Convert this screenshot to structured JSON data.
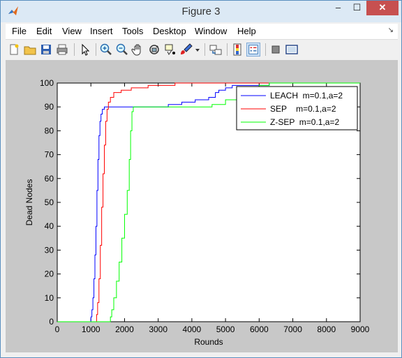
{
  "window": {
    "title": "Figure 3",
    "minimize_glyph": "–",
    "maximize_glyph": "☐",
    "close_glyph": "✕"
  },
  "menu": [
    "File",
    "Edit",
    "View",
    "Insert",
    "Tools",
    "Desktop",
    "Window",
    "Help"
  ],
  "dock_glyph": "↘",
  "toolbar": [
    "new-figure-icon",
    "open-file-icon",
    "save-icon",
    "print-icon",
    "pointer-icon",
    "zoom-in-icon",
    "zoom-out-icon",
    "pan-icon",
    "rotate-3d-icon",
    "data-cursor-icon",
    "brush-icon",
    "brush-dropdown-icon",
    "link-plot-icon",
    "insert-colorbar-icon",
    "insert-legend-icon",
    "hide-plot-tools-icon",
    "show-plot-tools-icon"
  ],
  "chart_data": {
    "type": "line",
    "xlabel": "Rounds",
    "ylabel": "Dead Nodes",
    "xlim": [
      0,
      9000
    ],
    "ylim": [
      0,
      100
    ],
    "xticks": [
      0,
      1000,
      2000,
      3000,
      4000,
      5000,
      6000,
      7000,
      8000,
      9000
    ],
    "yticks": [
      0,
      10,
      20,
      30,
      40,
      50,
      60,
      70,
      80,
      90,
      100
    ],
    "grid": false,
    "legend_position": "top-right",
    "series": [
      {
        "name": "LEACH  m=0.1,a=2",
        "color": "#0000ff",
        "points": [
          [
            0,
            0
          ],
          [
            980,
            0
          ],
          [
            1000,
            2
          ],
          [
            1030,
            5
          ],
          [
            1060,
            10
          ],
          [
            1090,
            18
          ],
          [
            1120,
            28
          ],
          [
            1150,
            40
          ],
          [
            1180,
            55
          ],
          [
            1210,
            68
          ],
          [
            1240,
            78
          ],
          [
            1270,
            84
          ],
          [
            1300,
            87
          ],
          [
            1340,
            89
          ],
          [
            1400,
            90
          ],
          [
            3100,
            90
          ],
          [
            3300,
            91
          ],
          [
            3700,
            92
          ],
          [
            4100,
            93
          ],
          [
            4500,
            94
          ],
          [
            4700,
            96
          ],
          [
            4800,
            97
          ],
          [
            5000,
            98
          ],
          [
            5200,
            99
          ],
          [
            6200,
            99
          ],
          [
            6300,
            100
          ],
          [
            9000,
            100
          ]
        ]
      },
      {
        "name": "SEP    m=0.1,a=2",
        "color": "#ff0000",
        "points": [
          [
            0,
            0
          ],
          [
            1150,
            0
          ],
          [
            1170,
            3
          ],
          [
            1200,
            8
          ],
          [
            1240,
            18
          ],
          [
            1280,
            32
          ],
          [
            1320,
            48
          ],
          [
            1360,
            62
          ],
          [
            1400,
            74
          ],
          [
            1440,
            84
          ],
          [
            1480,
            89
          ],
          [
            1520,
            92
          ],
          [
            1580,
            94
          ],
          [
            1680,
            96
          ],
          [
            1900,
            97
          ],
          [
            2200,
            98
          ],
          [
            2700,
            99
          ],
          [
            3500,
            100
          ],
          [
            9000,
            100
          ]
        ]
      },
      {
        "name": "Z-SEP  m=0.1,a=2",
        "color": "#00ff00",
        "points": [
          [
            0,
            0
          ],
          [
            1550,
            0
          ],
          [
            1580,
            2
          ],
          [
            1620,
            5
          ],
          [
            1680,
            10
          ],
          [
            1760,
            17
          ],
          [
            1840,
            25
          ],
          [
            1920,
            35
          ],
          [
            2000,
            45
          ],
          [
            2080,
            55
          ],
          [
            2140,
            68
          ],
          [
            2180,
            80
          ],
          [
            2220,
            88
          ],
          [
            2260,
            90
          ],
          [
            4200,
            90
          ],
          [
            4600,
            91
          ],
          [
            5000,
            93
          ],
          [
            5400,
            95
          ],
          [
            5600,
            97
          ],
          [
            5800,
            98
          ],
          [
            6000,
            99
          ],
          [
            6300,
            100
          ],
          [
            9000,
            100
          ]
        ]
      }
    ]
  }
}
